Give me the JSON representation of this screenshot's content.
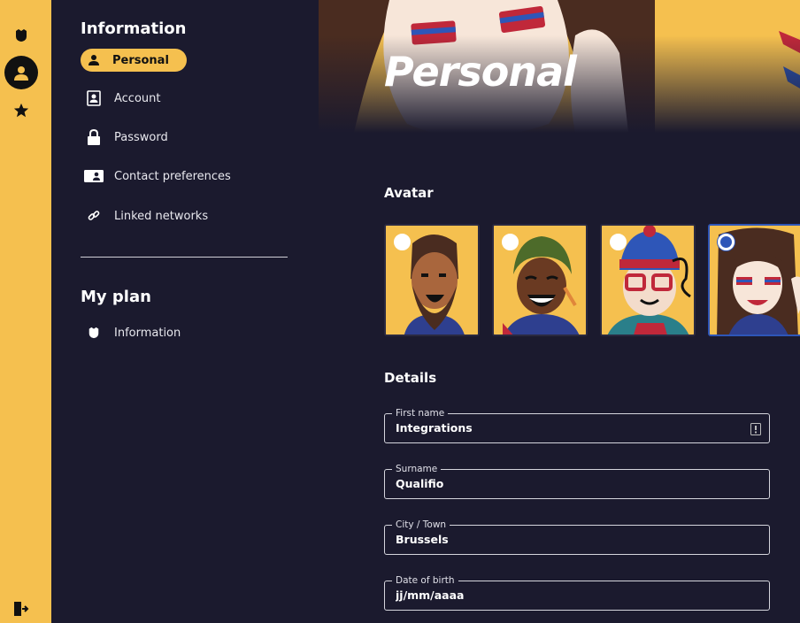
{
  "rail": {
    "items": [
      {
        "name": "shield-icon"
      },
      {
        "name": "user-icon",
        "active": true
      },
      {
        "name": "star-icon"
      }
    ],
    "logout_icon": "logout-icon"
  },
  "sidebar": {
    "information_heading": "Information",
    "items": [
      {
        "label": "Personal",
        "icon": "person-icon",
        "active": true
      },
      {
        "label": "Account",
        "icon": "id-card-icon"
      },
      {
        "label": "Password",
        "icon": "lock-icon"
      },
      {
        "label": "Contact preferences",
        "icon": "contact-card-icon"
      },
      {
        "label": "Linked networks",
        "icon": "link-icon"
      }
    ],
    "plan_heading": "My plan",
    "plan_items": [
      {
        "label": "Information",
        "icon": "shield-icon"
      }
    ]
  },
  "main": {
    "hero_title": "Personal",
    "avatar_heading": "Avatar",
    "avatars": [
      {
        "name": "bearded-man",
        "selected": false
      },
      {
        "name": "woman-headscarf",
        "selected": false
      },
      {
        "name": "man-glasses-beanie",
        "selected": false
      },
      {
        "name": "woman-face-paint",
        "selected": true
      }
    ],
    "details_heading": "Details",
    "fields": {
      "first_name": {
        "label": "First name",
        "value": "Integrations"
      },
      "surname": {
        "label": "Surname",
        "value": "Qualifio"
      },
      "city": {
        "label": "City / Town",
        "value": "Brussels"
      },
      "dob": {
        "label": "Date of birth",
        "placeholder": "jj/mm/aaaa"
      }
    }
  },
  "colors": {
    "accent": "#f5c04f",
    "background": "#1b1a2e",
    "selected_border": "#2e56b8"
  }
}
